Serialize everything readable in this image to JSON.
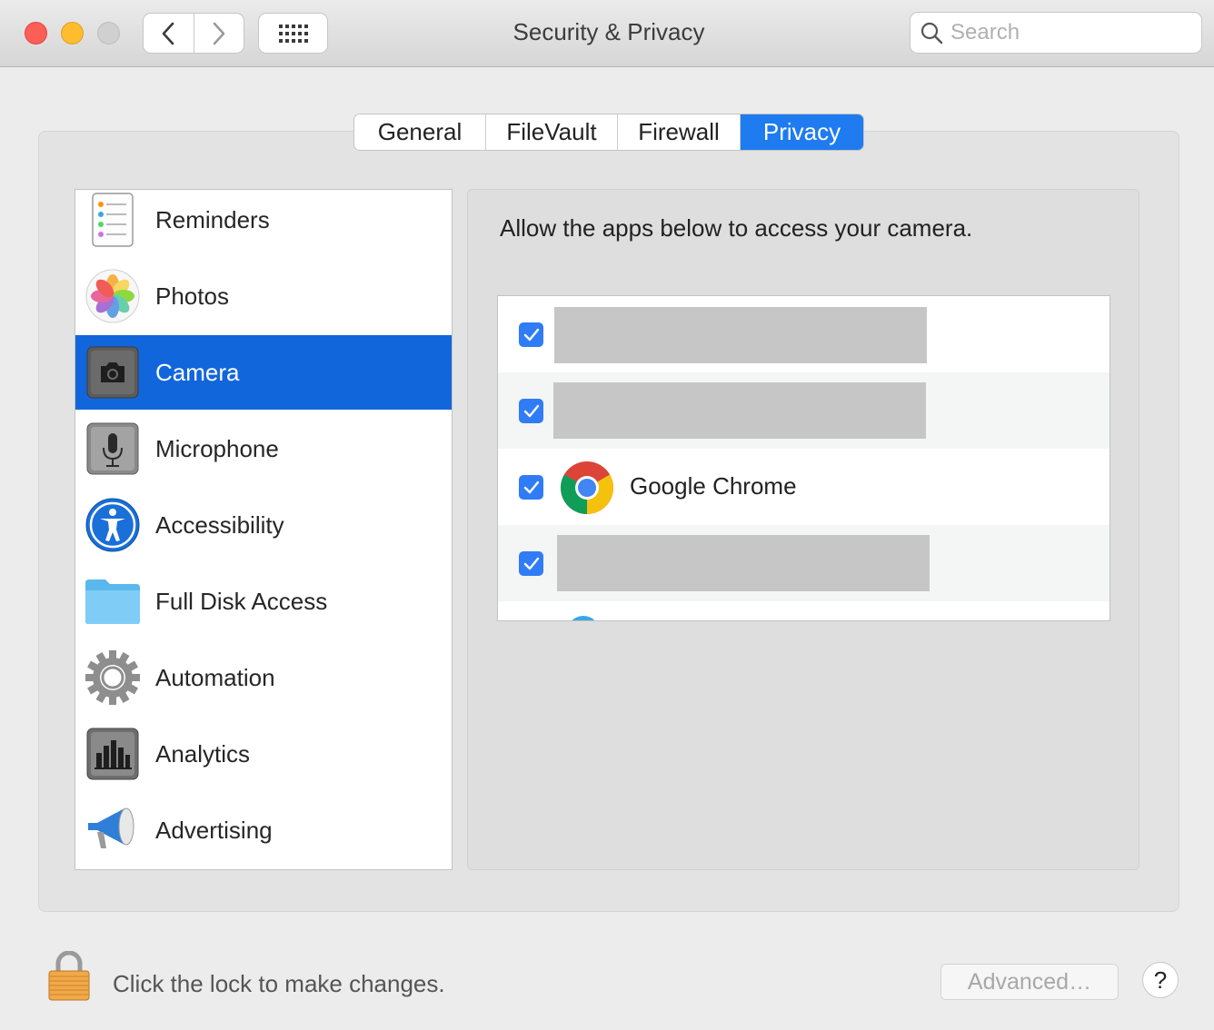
{
  "window": {
    "title": "Security & Privacy",
    "search_placeholder": "Search"
  },
  "tabs": [
    {
      "label": "General",
      "active": false
    },
    {
      "label": "FileVault",
      "active": false
    },
    {
      "label": "Firewall",
      "active": false
    },
    {
      "label": "Privacy",
      "active": true
    }
  ],
  "sidebar": {
    "items": [
      {
        "label": "Reminders",
        "icon": "reminders-icon",
        "selected": false
      },
      {
        "label": "Photos",
        "icon": "photos-icon",
        "selected": false
      },
      {
        "label": "Camera",
        "icon": "camera-icon",
        "selected": true
      },
      {
        "label": "Microphone",
        "icon": "microphone-icon",
        "selected": false
      },
      {
        "label": "Accessibility",
        "icon": "accessibility-icon",
        "selected": false
      },
      {
        "label": "Full Disk Access",
        "icon": "folder-icon",
        "selected": false
      },
      {
        "label": "Automation",
        "icon": "gear-icon",
        "selected": false
      },
      {
        "label": "Analytics",
        "icon": "analytics-icon",
        "selected": false
      },
      {
        "label": "Advertising",
        "icon": "megaphone-icon",
        "selected": false
      }
    ]
  },
  "main": {
    "prompt": "Allow the apps below to access your camera.",
    "apps": [
      {
        "name": "",
        "checked": true,
        "redacted": true
      },
      {
        "name": "",
        "checked": true,
        "redacted": true
      },
      {
        "name": "Google Chrome",
        "checked": true,
        "redacted": false
      },
      {
        "name": "",
        "checked": true,
        "redacted": true
      }
    ]
  },
  "footer": {
    "lock_text": "Click the lock to make changes.",
    "advanced_label": "Advanced…",
    "help_label": "?"
  },
  "colors": {
    "accent": "#1266dc",
    "tab_active": "#1f7bf0",
    "checkbox": "#2f7cf6"
  }
}
